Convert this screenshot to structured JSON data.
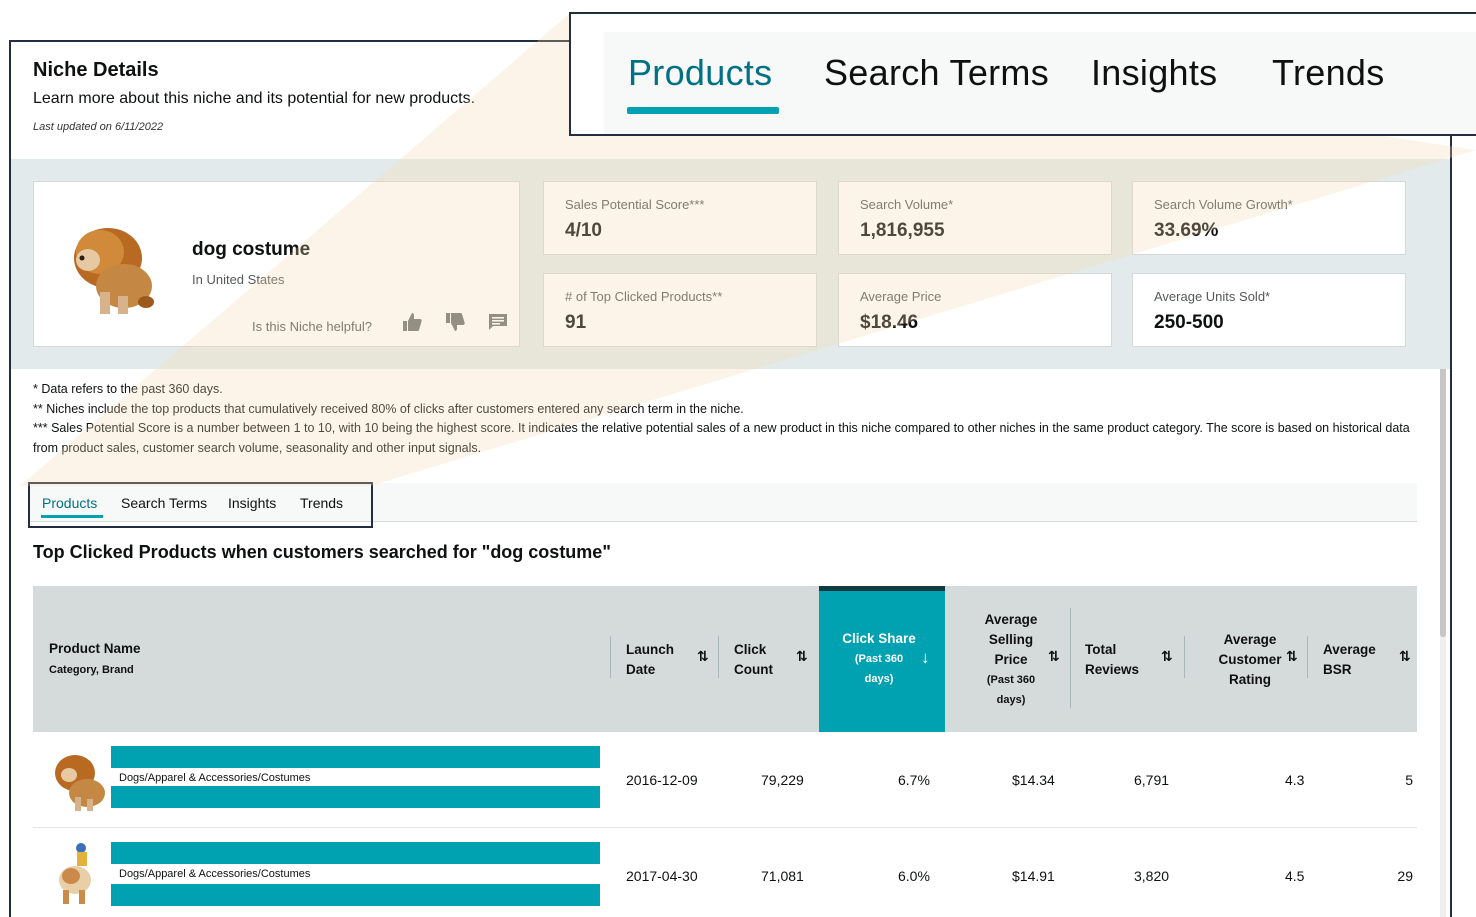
{
  "header": {
    "title": "Niche Details",
    "subtitle": "Learn more about this niche and its potential for new products.",
    "last_updated": "Last updated on 6/11/2022"
  },
  "niche": {
    "name": "dog costume",
    "country": "In United States",
    "helpful_prompt": "Is this Niche helpful?",
    "icons": [
      "thumbs-up-icon",
      "thumbs-down-icon",
      "comment-icon"
    ]
  },
  "metrics": [
    {
      "label": "Sales Potential Score***",
      "value": "4/10"
    },
    {
      "label": "Search Volume*",
      "value": "1,816,955"
    },
    {
      "label": "Search Volume Growth*",
      "value": "33.69%"
    },
    {
      "label": "# of Top Clicked Products**",
      "value": "91"
    },
    {
      "label": "Average Price",
      "value": "$18.46"
    },
    {
      "label": "Average Units Sold*",
      "value": "250-500"
    }
  ],
  "notes": {
    "n1": "* Data refers to the past 360 days.",
    "n2": "** Niches include the top products that cumulatively received 80% of clicks after customers entered any search term in the niche.",
    "n3": "*** Sales Potential Score is a number between 1 to 10, with 10 being the highest score. It indicates the relative potential sales of a new product in this niche compared to other niches in the same product category. The score is based on historical data from product sales, customer search volume, seasonality and other input signals."
  },
  "tabs": [
    "Products",
    "Search Terms",
    "Insights",
    "Trends"
  ],
  "active_tab": "Products",
  "section_title": "Top Clicked Products when customers searched for \"dog costume\"",
  "table": {
    "headers": {
      "product_name": "Product Name",
      "product_sub": "Category, Brand",
      "launch_1": "Launch",
      "launch_2": "Date",
      "click_1": "Click",
      "click_2": "Count",
      "share_1": "Click Share",
      "share_2": "(Past 360",
      "share_3": "days)",
      "price_1": "Average",
      "price_2": "Selling",
      "price_3": "Price",
      "price_4": "(Past 360",
      "price_5": "days)",
      "reviews_1": "Total",
      "reviews_2": "Reviews",
      "rating_1": "Average",
      "rating_2": "Customer",
      "rating_3": "Rating",
      "bsr_1": "Average",
      "bsr_2": "BSR"
    },
    "rows": [
      {
        "category": "Dogs/Apparel & Accessories/Costumes",
        "launch": "2016-12-09",
        "clicks": "79,229",
        "share": "6.7%",
        "price": "$14.34",
        "reviews": "6,791",
        "rating": "4.3",
        "bsr": "5"
      },
      {
        "category": "Dogs/Apparel & Accessories/Costumes",
        "launch": "2017-04-30",
        "clicks": "71,081",
        "share": "6.0%",
        "price": "$14.91",
        "reviews": "3,820",
        "rating": "4.5",
        "bsr": "29"
      }
    ]
  },
  "colors": {
    "accent": "#00a1b0",
    "active_tab_text": "#007185",
    "band": "#e3eaeb",
    "header_row": "#d5dbdb",
    "frame": "#232f3e"
  }
}
